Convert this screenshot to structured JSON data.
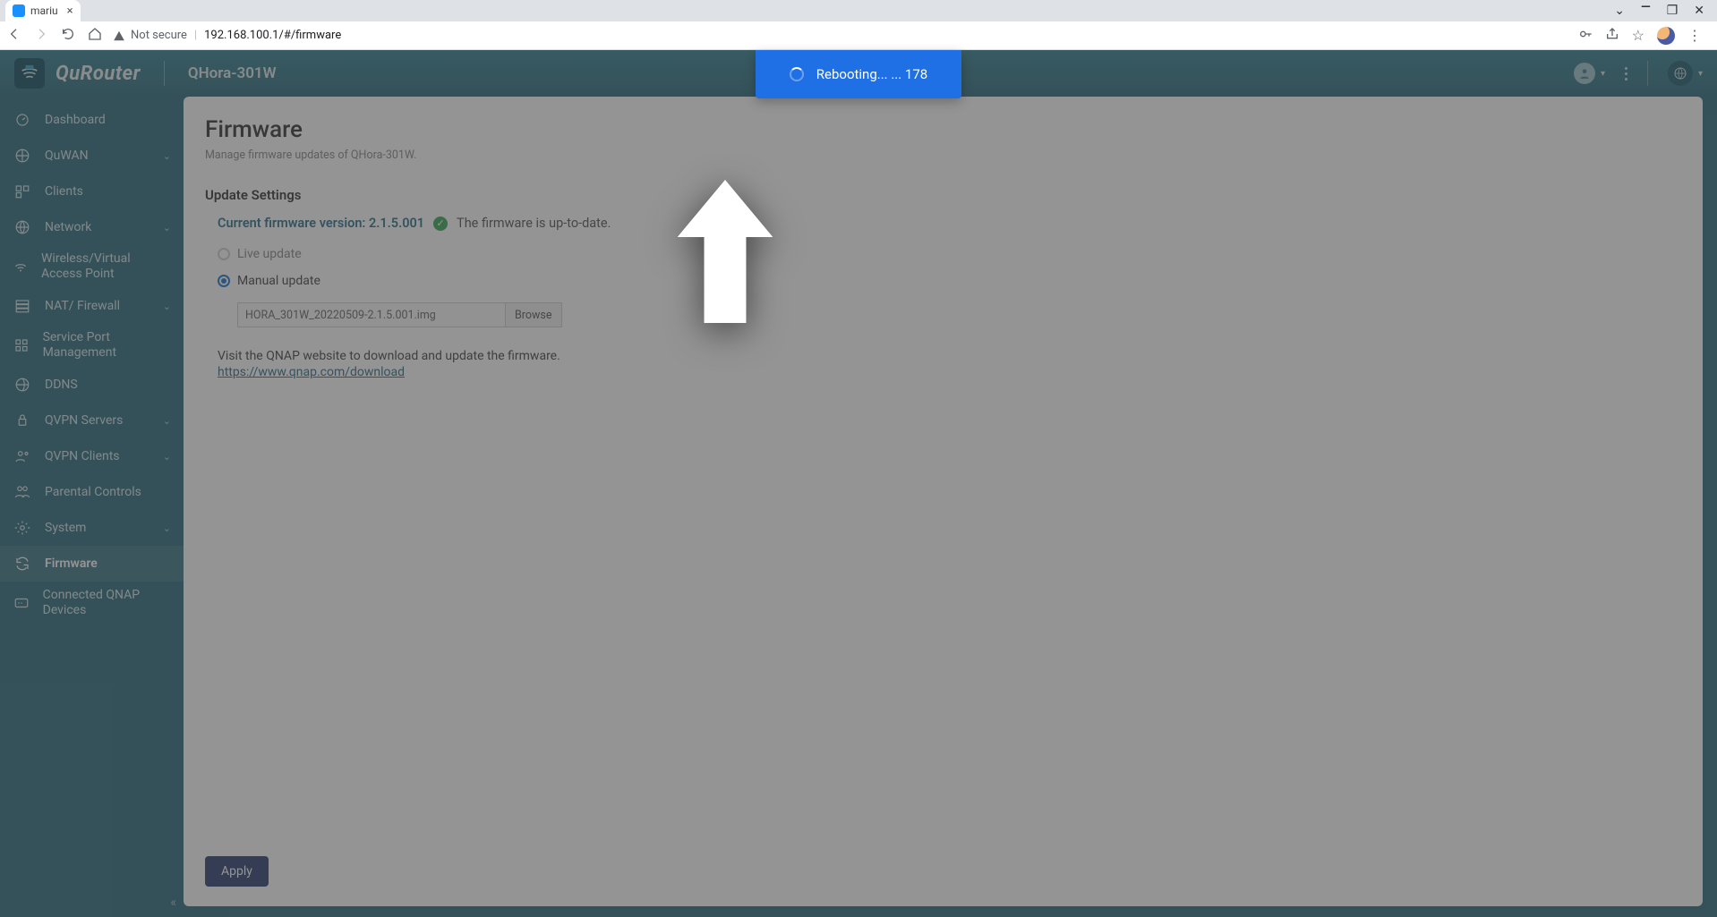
{
  "browser": {
    "tab_title": "mariu",
    "security_label": "Not secure",
    "url": "192.168.100.1/#/firmware"
  },
  "header": {
    "brand": "QuRouter",
    "model": "QHora-301W"
  },
  "sidebar": {
    "items": [
      {
        "label": "Dashboard",
        "expandable": false
      },
      {
        "label": "QuWAN",
        "expandable": true
      },
      {
        "label": "Clients",
        "expandable": false
      },
      {
        "label": "Network",
        "expandable": true
      },
      {
        "label": "Wireless/Virtual Access Point",
        "expandable": false
      },
      {
        "label": "NAT/ Firewall",
        "expandable": true
      },
      {
        "label": "Service Port Management",
        "expandable": false
      },
      {
        "label": "DDNS",
        "expandable": false
      },
      {
        "label": "QVPN Servers",
        "expandable": true
      },
      {
        "label": "QVPN Clients",
        "expandable": true
      },
      {
        "label": "Parental Controls",
        "expandable": false
      },
      {
        "label": "System",
        "expandable": true
      },
      {
        "label": "Firmware",
        "expandable": false
      },
      {
        "label": "Connected QNAP Devices",
        "expandable": false
      }
    ],
    "active_index": 12
  },
  "page": {
    "title": "Firmware",
    "subtitle": "Manage firmware updates of QHora-301W.",
    "section": "Update Settings",
    "current_label": "Current firmware version: 2.1.5.001",
    "status_text": "The firmware is up-to-date.",
    "radio_live": "Live update",
    "radio_manual": "Manual update",
    "selected_radio": "manual",
    "file_name": "HORA_301W_20220509-2.1.5.001.img",
    "browse_label": "Browse",
    "help_line": "Visit the QNAP website to download and update the firmware.",
    "help_link": "https://www.qnap.com/download",
    "apply_label": "Apply"
  },
  "toast": {
    "text": "Rebooting... ... 178"
  }
}
